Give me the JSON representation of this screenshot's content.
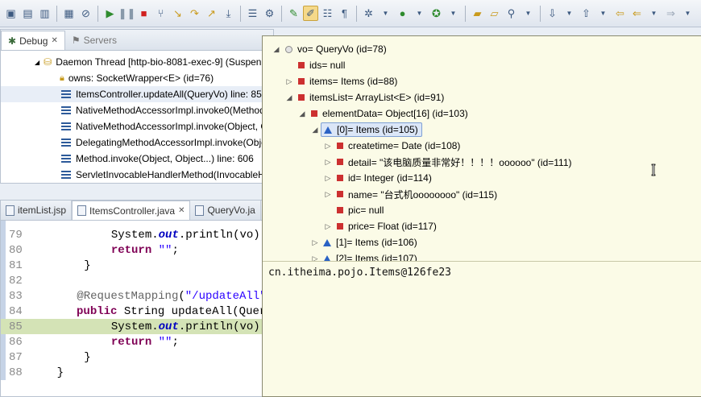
{
  "toolbar": {
    "icons": [
      "new-icon",
      "save-icon",
      "save-all-icon",
      "print-icon",
      "skip-breakpoints-icon",
      "resume-icon",
      "suspend-icon",
      "terminate-icon",
      "disconnect-icon",
      "step-into-icon",
      "step-over-icon",
      "step-return-icon",
      "drop-to-frame-icon",
      "use-step-filters-icon",
      "open-type-icon",
      "toggle-mark-icon",
      "toggle-highlight-icon",
      "block-select-icon",
      "show-whitespace-icon",
      "debug-icon",
      "run-icon",
      "external-tools-icon",
      "open-folder-icon",
      "new-folder-icon",
      "search-icon",
      "next-annotation-icon",
      "prev-annotation-icon",
      "back-icon",
      "forward-icon"
    ]
  },
  "debug_view": {
    "tabs": [
      {
        "label": "Debug",
        "close": "✕"
      },
      {
        "label": "Servers"
      }
    ],
    "thread": "Daemon Thread [http-bio-8081-exec-9] (Suspen",
    "owns": "owns: SocketWrapper<E>  (id=76)",
    "frames": [
      "ItemsController.updateAll(QueryVo) line: 85",
      "NativeMethodAccessorImpl.invoke0(Method",
      "NativeMethodAccessorImpl.invoke(Object, O",
      "DelegatingMethodAccessorImpl.invoke(Obje",
      "Method.invoke(Object, Object...) line: 606",
      "ServletInvocableHandlerMethod(InvocableHa"
    ]
  },
  "editor": {
    "tabs": [
      {
        "label": "itemList.jsp"
      },
      {
        "label": "ItemsController.java",
        "close": "✕"
      },
      {
        "label": "QueryVo.ja"
      }
    ],
    "lines": [
      {
        "num": "79",
        "text": "            System.out.println(vo);"
      },
      {
        "num": "80",
        "text": "            return \"\";"
      },
      {
        "num": "81",
        "text": "        }"
      },
      {
        "num": "82",
        "text": ""
      },
      {
        "num": "83",
        "text": "        @RequestMapping(\"/updateAll\")"
      },
      {
        "num": "84",
        "text": "        public String updateAll(QueryVo"
      },
      {
        "num": "85",
        "text": "            System.out.println(vo);"
      },
      {
        "num": "86",
        "text": "            return \"\";"
      },
      {
        "num": "87",
        "text": "        }"
      },
      {
        "num": "88",
        "text": "    }"
      }
    ]
  },
  "inspect_popup": {
    "tree": [
      {
        "label": "vo= QueryVo  (id=78)"
      },
      {
        "label": "ids= null"
      },
      {
        "label": "items= Items  (id=88)"
      },
      {
        "label": "itemsList= ArrayList<E>  (id=91)"
      },
      {
        "label": "elementData= Object[16]  (id=103)"
      },
      {
        "label": "[0]= Items  (id=105)"
      },
      {
        "label": "createtime= Date  (id=108)"
      },
      {
        "label": "detail= \"该电脑质量非常好！！！！oooooo\" (id=111)"
      },
      {
        "label": "id= Integer  (id=114)"
      },
      {
        "label": "name= \"台式机oooooooo\" (id=115)"
      },
      {
        "label": "pic= null"
      },
      {
        "label": "price= Float  (id=117)"
      },
      {
        "label": "[1]= Items  (id=106)"
      },
      {
        "label": "[2]= Items  (id=107)"
      }
    ],
    "detail_text": "cn.itheima.pojo.Items@126fe23"
  }
}
